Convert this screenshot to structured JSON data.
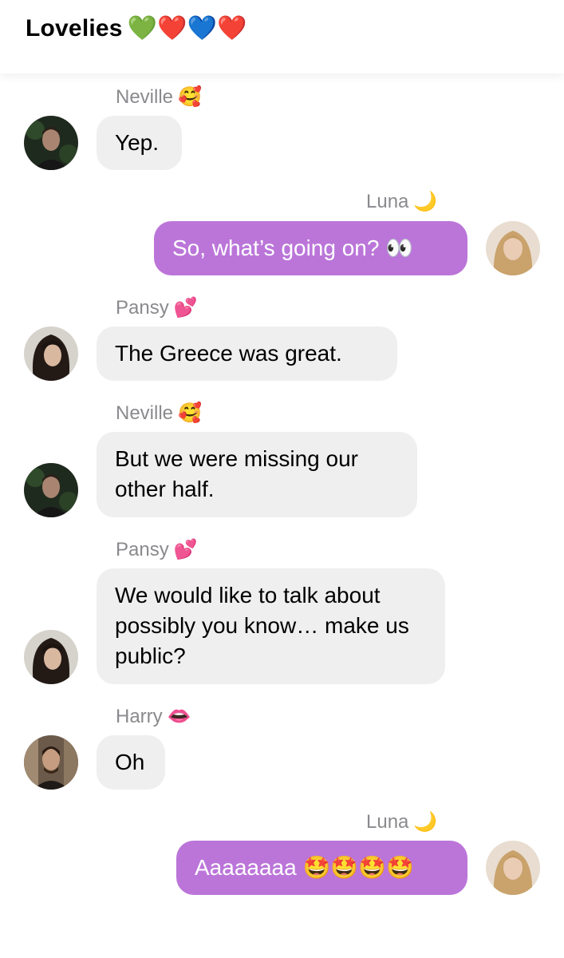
{
  "chat": {
    "title": "Lovelies",
    "title_emojis": "💚❤️💙❤️"
  },
  "messages": [
    {
      "sender": "Neville",
      "sender_emoji": "🥰",
      "text": "Yep.",
      "side": "incoming"
    },
    {
      "sender": "Luna",
      "sender_emoji": "🌙",
      "text": "So, what’s going on? 👀",
      "side": "outgoing"
    },
    {
      "sender": "Pansy",
      "sender_emoji": "💕",
      "text": "The Greece was great.",
      "side": "incoming"
    },
    {
      "sender": "Neville",
      "sender_emoji": "🥰",
      "text": "But we were missing our other half.",
      "side": "incoming"
    },
    {
      "sender": "Pansy",
      "sender_emoji": "💕",
      "text": "We would like to talk about possibly you know… make us public?",
      "side": "incoming"
    },
    {
      "sender": "Harry",
      "sender_emoji": "👄",
      "text": "Oh",
      "side": "incoming"
    },
    {
      "sender": "Luna",
      "sender_emoji": "🌙",
      "text": "Aaaaaaaa 🤩🤩🤩🤩",
      "side": "outgoing"
    }
  ],
  "colors": {
    "outgoing_bubble": "#bb75d9",
    "incoming_bubble": "#efefef",
    "sender_name": "#8a8a8e"
  }
}
